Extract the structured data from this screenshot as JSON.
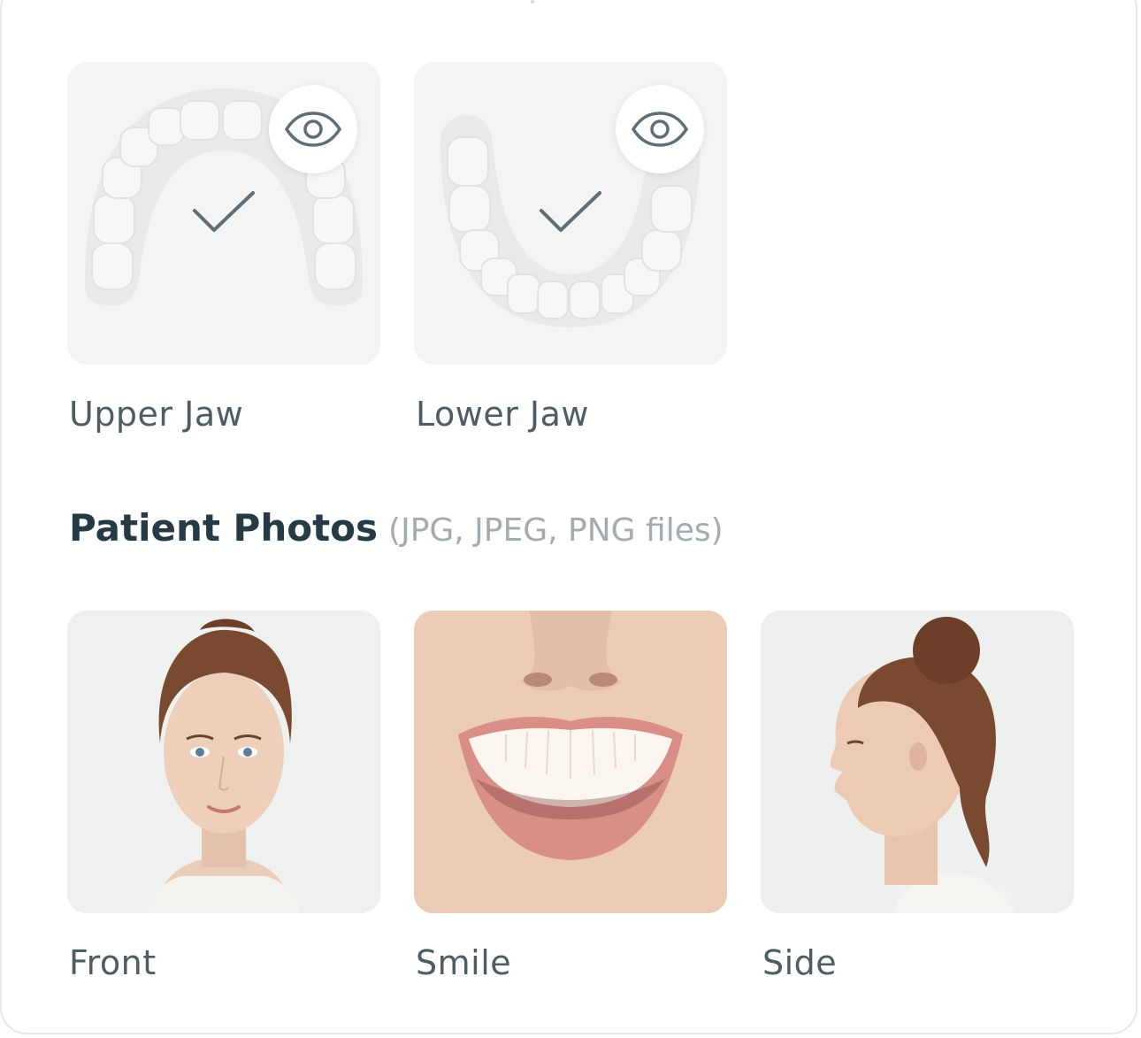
{
  "scans": [
    {
      "label": "Upper Jaw",
      "status": "uploaded",
      "action_icon": "eye-icon"
    },
    {
      "label": "Lower Jaw",
      "status": "uploaded",
      "action_icon": "eye-icon"
    }
  ],
  "photos_section": {
    "title": "Patient Photos",
    "subtitle": "(JPG, JPEG, PNG files)"
  },
  "photos": [
    {
      "label": "Front"
    },
    {
      "label": "Smile"
    },
    {
      "label": "Side"
    }
  ],
  "colors": {
    "tile_bg": "#f3f4f4",
    "label": "#4e5c64",
    "title": "#253a44",
    "subtitle": "#a3acb1",
    "icon": "#5f6e76"
  }
}
